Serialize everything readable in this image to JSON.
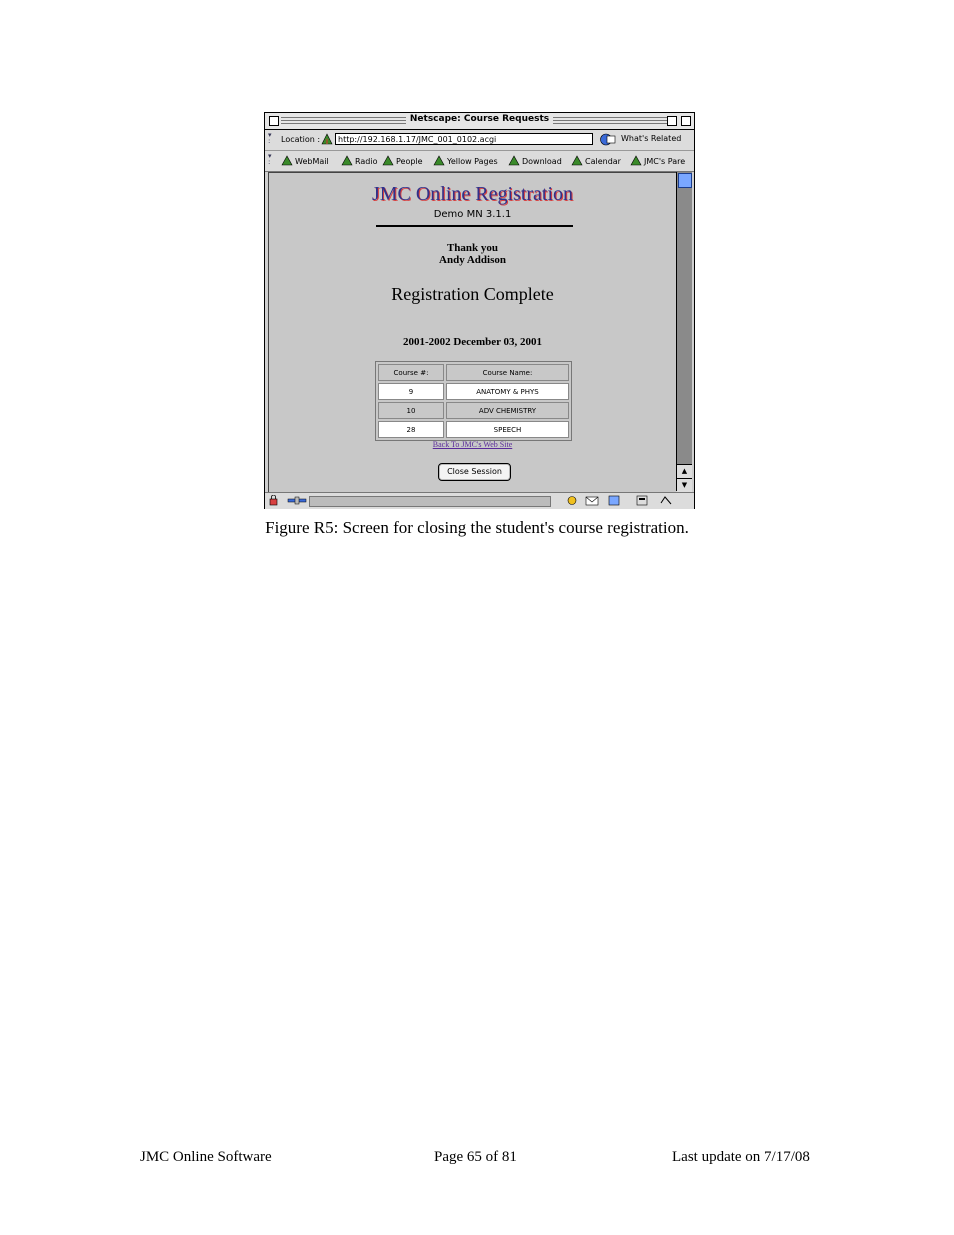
{
  "window": {
    "title": "Netscape: Course Requests",
    "location_label": "Location :",
    "location_url": "http://192.168.1.17/JMC_001_0102.acgi",
    "whats_related": "What's Related",
    "personal_toolbar": [
      "WebMail",
      "Radio",
      "People",
      "Yellow Pages",
      "Download",
      "Calendar",
      "JMC's Pare"
    ]
  },
  "page": {
    "site_title": "JMC Online Registration",
    "version": "Demo MN 3.1.1",
    "thanks_line1": "Thank you",
    "thanks_line2": "Andy Addison",
    "heading": "Registration Complete",
    "date": "2001-2002 December 03, 2001",
    "table": {
      "headers": [
        "Course #:",
        "Course Name:"
      ],
      "rows": [
        [
          "9",
          "ANATOMY & PHYS"
        ],
        [
          "10",
          "ADV CHEMISTRY"
        ],
        [
          "28",
          "SPEECH"
        ]
      ]
    },
    "back_link": "Back To JMC's Web Site",
    "close_button": "Close Session"
  },
  "caption": "Figure R5: Screen for closing the student's course registration.",
  "footer": {
    "left": "JMC Online Software",
    "center": "Page 65 of 81",
    "right": "Last update on 7/17/08"
  }
}
